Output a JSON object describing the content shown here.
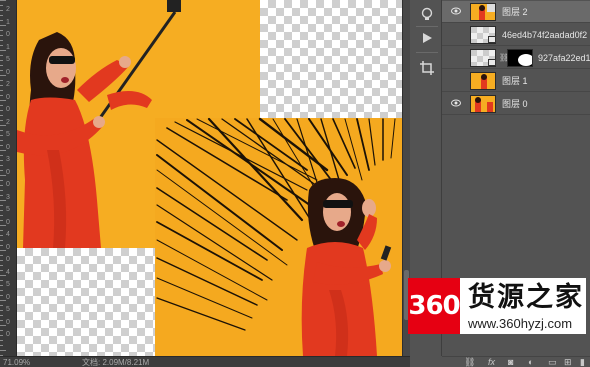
{
  "ruler": {
    "labels": [
      "2",
      "1",
      "0",
      "1",
      "5",
      "0",
      "2",
      "0",
      "0",
      "2",
      "5",
      "0",
      "3",
      "0",
      "0",
      "3",
      "5",
      "0",
      "4",
      "0",
      "0",
      "4",
      "5",
      "0",
      "5",
      "0",
      "0"
    ]
  },
  "status": {
    "zoom": "71.09%",
    "doc": "文档: 2.09M/8.21M"
  },
  "tools": [
    "history-brush-icon",
    "play-icon",
    "crop-icon"
  ],
  "layers": [
    {
      "name": "图层 2",
      "visible": true,
      "selected": true,
      "type": "photo"
    },
    {
      "name": "46ed4b74f2aadad0f2",
      "visible": false,
      "selected": false,
      "type": "smart"
    },
    {
      "name": "927afa22ed1",
      "visible": false,
      "selected": false,
      "type": "smart-masked"
    },
    {
      "name": "图层 1",
      "visible": false,
      "selected": false,
      "type": "orange"
    },
    {
      "name": "图层 0",
      "visible": true,
      "selected": false,
      "type": "photo"
    }
  ],
  "footer_icons": [
    "link-icon",
    "fx-icon",
    "mask-icon",
    "adjustment-icon",
    "folder-icon",
    "new-layer-icon",
    "trash-icon"
  ],
  "watermark": {
    "logo": "360",
    "title": "货源之家",
    "url": "www.360hyzj.com"
  },
  "colors": {
    "yellow": "#f6ad22",
    "red_dress": "#e2391f",
    "panel": "#535353",
    "selected_layer": "#6a6a6a",
    "logo_red": "#e60012"
  }
}
